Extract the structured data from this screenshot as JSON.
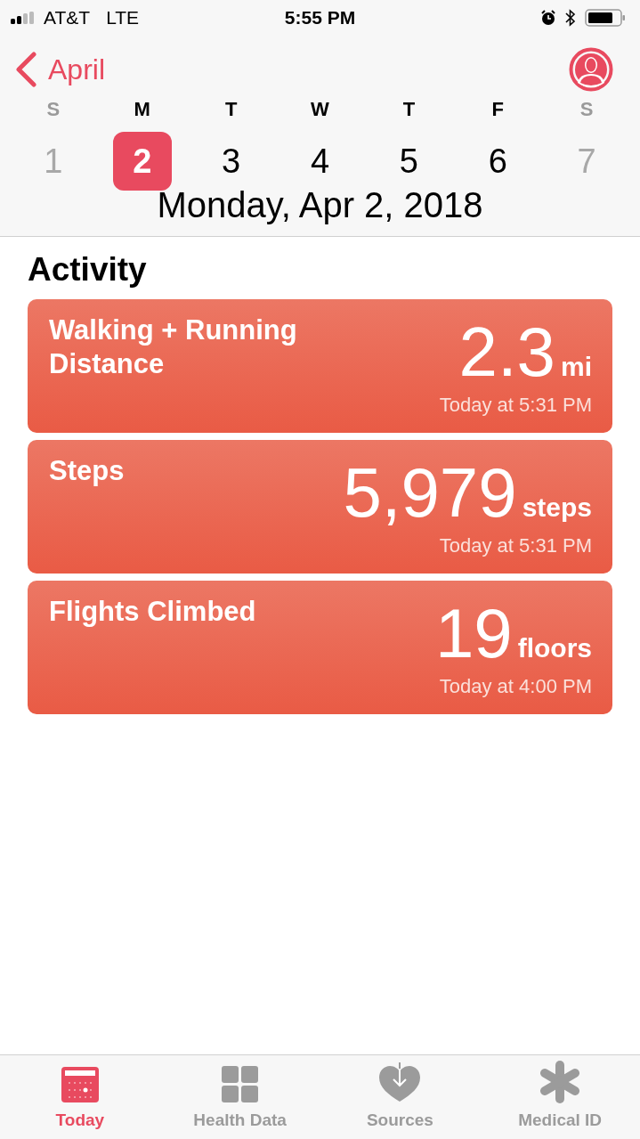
{
  "status_bar": {
    "carrier": "AT&T",
    "network": "LTE",
    "time": "5:55 PM"
  },
  "nav": {
    "back_label": "April"
  },
  "week": [
    {
      "letter": "S",
      "day": "1",
      "dimmed": true,
      "selected": false
    },
    {
      "letter": "M",
      "day": "2",
      "dimmed": false,
      "selected": true
    },
    {
      "letter": "T",
      "day": "3",
      "dimmed": false,
      "selected": false
    },
    {
      "letter": "W",
      "day": "4",
      "dimmed": false,
      "selected": false
    },
    {
      "letter": "T",
      "day": "5",
      "dimmed": false,
      "selected": false
    },
    {
      "letter": "F",
      "day": "6",
      "dimmed": false,
      "selected": false
    },
    {
      "letter": "S",
      "day": "7",
      "dimmed": true,
      "selected": false
    }
  ],
  "date_title": "Monday, Apr 2, 2018",
  "section_title": "Activity",
  "cards": [
    {
      "title": "Walking + Running Distance",
      "value": "2.3",
      "unit": "mi",
      "time": "Today at 5:31 PM"
    },
    {
      "title": "Steps",
      "value": "5,979",
      "unit": "steps",
      "time": "Today at 5:31 PM"
    },
    {
      "title": "Flights Climbed",
      "value": "19",
      "unit": "floors",
      "time": "Today at 4:00 PM"
    }
  ],
  "tabs": [
    {
      "label": "Today",
      "kind": "calendar",
      "selected": true
    },
    {
      "label": "Health Data",
      "kind": "grid",
      "selected": false
    },
    {
      "label": "Sources",
      "kind": "heart",
      "selected": false
    },
    {
      "label": "Medical ID",
      "kind": "asterisk",
      "selected": false
    }
  ]
}
